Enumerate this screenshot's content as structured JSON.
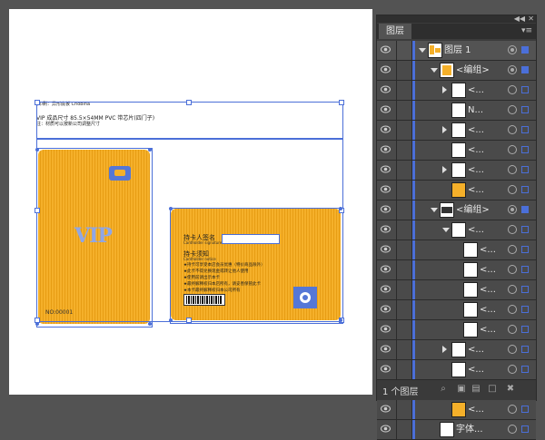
{
  "artboard": {
    "header_line1": "[印刷：异形底板 Chobina",
    "header_line2": "VIP 成品尺寸 85.5×54MM PVC 带芯片(四门子)",
    "header_line3": "注：材质可以按新公司调整尺寸"
  },
  "front_card": {
    "vip_text": "VIP",
    "number": "NO:00001"
  },
  "back_card": {
    "holder_label": "持卡人签名",
    "holder_sub": "Cardholder signature",
    "notice_title": "持卡须知",
    "notice_sub": "Cardholder notice",
    "rules": [
      "★持卡可享受本店会员优惠（特价商品除外）",
      "★此卡不得兑换现金或转让他人使用",
      "★使用前请出示本卡",
      "★最终解释权归本店所有，请妥善保管此卡",
      "★本卡最终解释权归本公司所有"
    ]
  },
  "panel": {
    "tab_label": "图层",
    "menu_icon": "panel-menu-icon",
    "layer_count": "1 个图层",
    "layers": [
      {
        "label": "图层 1",
        "indent": 0,
        "expand": "down",
        "thumb": "layer"
      },
      {
        "label": "<编组>",
        "indent": 1,
        "expand": "down",
        "thumb": "card-orange"
      },
      {
        "label": "<...",
        "indent": 2,
        "expand": "right",
        "thumb": "white"
      },
      {
        "label": "N...",
        "indent": 2,
        "expand": "",
        "thumb": "white"
      },
      {
        "label": "<...",
        "indent": 2,
        "expand": "right",
        "thumb": "white"
      },
      {
        "label": "<...",
        "indent": 2,
        "expand": "",
        "thumb": "white"
      },
      {
        "label": "<...",
        "indent": 2,
        "expand": "right",
        "thumb": "white"
      },
      {
        "label": "<...",
        "indent": 2,
        "expand": "",
        "thumb": "orange"
      },
      {
        "label": "<编组>",
        "indent": 1,
        "expand": "down",
        "thumb": "card-dark"
      },
      {
        "label": "<...",
        "indent": 2,
        "expand": "down",
        "thumb": "white"
      },
      {
        "label": "<...",
        "indent": 3,
        "expand": "",
        "thumb": "white"
      },
      {
        "label": "<...",
        "indent": 3,
        "expand": "",
        "thumb": "white"
      },
      {
        "label": "<...",
        "indent": 3,
        "expand": "",
        "thumb": "white"
      },
      {
        "label": "<...",
        "indent": 3,
        "expand": "",
        "thumb": "white"
      },
      {
        "label": "<...",
        "indent": 3,
        "expand": "",
        "thumb": "white"
      },
      {
        "label": "<...",
        "indent": 2,
        "expand": "right",
        "thumb": "white"
      },
      {
        "label": "<...",
        "indent": 2,
        "expand": "",
        "thumb": "white"
      },
      {
        "label": "<...",
        "indent": 2,
        "expand": "",
        "thumb": "white"
      },
      {
        "label": "<...",
        "indent": 2,
        "expand": "",
        "thumb": "orange"
      },
      {
        "label": "字体...",
        "indent": 1,
        "expand": "",
        "thumb": "white"
      }
    ]
  },
  "colors": {
    "card_orange": "#f5b02a",
    "accent_blue": "#4b6fd8",
    "panel_bg": "#3c3c3c"
  }
}
